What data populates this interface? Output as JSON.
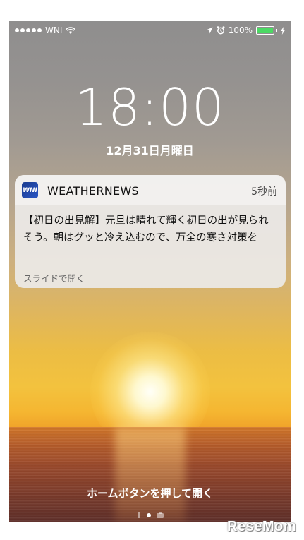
{
  "status_bar": {
    "carrier": "WNI",
    "battery": "100%"
  },
  "lock_screen": {
    "time": "18:00",
    "date": "12月31日月曜日",
    "home_hint": "ホームボタンを押して開く"
  },
  "notification": {
    "app_icon": "WNI",
    "app_name": "WEATHERNEWS",
    "time_ago": "5秒前",
    "body": "【初日の出見解】元旦は晴れて輝く初日の出が見られそう。朝はグッと冷え込むので、万全の寒さ対策を",
    "action": "スライドで開く"
  },
  "watermark": "ReseMom",
  "colors": {
    "battery_green": "#4cd964",
    "app_icon_blue": "#2b56c4"
  }
}
